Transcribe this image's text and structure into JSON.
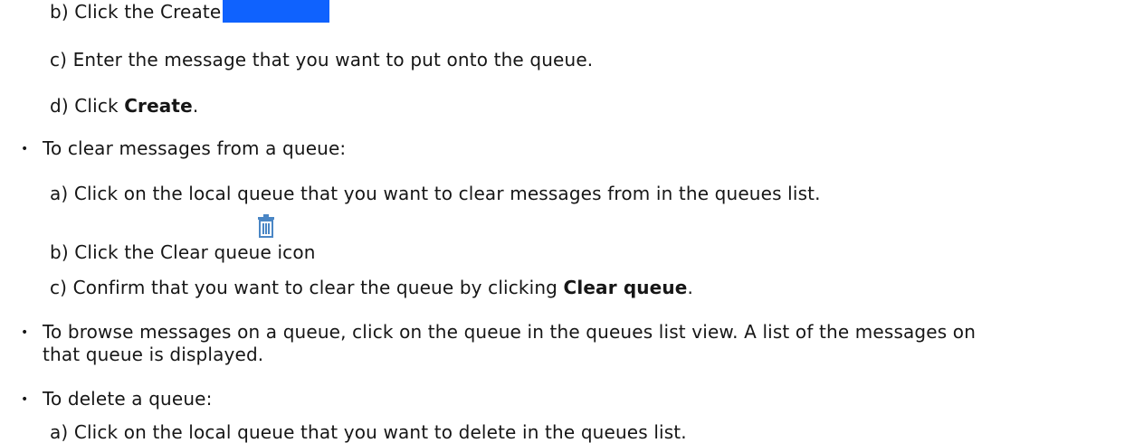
{
  "steps": {
    "create_b_label": "b) Click the Create button",
    "create_c": "c) Enter the message that you want to put onto the queue.",
    "create_d_prefix": "d) Click ",
    "create_d_bold": "Create",
    "create_d_suffix": ".",
    "clear_heading": "To clear messages from a queue:",
    "clear_a": "a) Click on the local queue that you want to clear messages from in the queues list.",
    "clear_b": "b) Click the Clear queue icon",
    "clear_c_prefix": "c) Confirm that you want to clear the queue by clicking ",
    "clear_c_bold": "Clear queue",
    "clear_c_suffix": ".",
    "browse_line1": "To browse messages on a queue, click on the queue in the queues list view. A list of the messages on",
    "browse_line2": "that queue is displayed.",
    "delete_heading": "To delete a queue:",
    "delete_a": "a) Click on the local queue that you want to delete in the queues list."
  },
  "bullet_glyph": "•",
  "colors": {
    "button_blue": "#0f62fe",
    "icon_blue": "#4a86c5"
  },
  "icons": {
    "create_button": "create-button",
    "clear_queue": "trash-icon"
  }
}
